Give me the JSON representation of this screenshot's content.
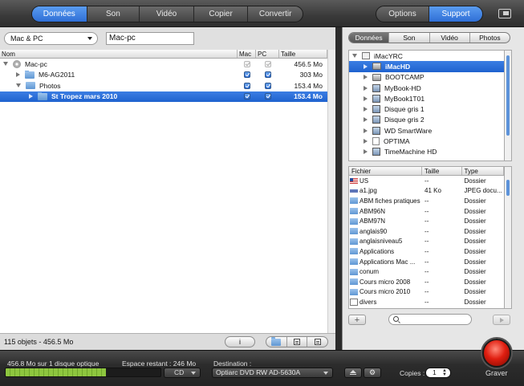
{
  "toolbar": {
    "left_tabs": [
      "Données",
      "Son",
      "Vidéo",
      "Copier",
      "Convertir"
    ],
    "right_tabs": [
      "Options",
      "Support"
    ],
    "window_icon": "window-toggle-icon"
  },
  "left": {
    "source_select": "Mac & PC",
    "disc_name": "Mac-pc",
    "columns": [
      "Nom",
      "Mac",
      "PC",
      "Taille"
    ],
    "rows": [
      {
        "name": "Mac-pc",
        "size": "456.5 Mo",
        "level": 0,
        "expanded": true,
        "icon": "disc-icon",
        "mac": "dim",
        "pc": "dim"
      },
      {
        "name": "M6-AG2011",
        "size": "303 Mo",
        "level": 1,
        "expanded": false,
        "icon": "folder-icon",
        "mac": "on",
        "pc": "on"
      },
      {
        "name": "Photos",
        "size": "153.4 Mo",
        "level": 1,
        "expanded": true,
        "icon": "folder-icon",
        "mac": "on",
        "pc": "on"
      },
      {
        "name": "St Tropez mars 2010",
        "size": "153.4 Mo",
        "level": 2,
        "expanded": false,
        "icon": "folder-icon",
        "mac": "on",
        "pc": "on",
        "selected": true
      }
    ],
    "status": "115 objets - 456.5 Mo",
    "info_label": "i"
  },
  "right": {
    "tabs": [
      "Données",
      "Son",
      "Vidéo",
      "Photos"
    ],
    "volumes": [
      {
        "name": "iMacYRC",
        "icon": "imac-icon",
        "level": 0,
        "expanded": true
      },
      {
        "name": "iMacHD",
        "icon": "hd-icon",
        "level": 1,
        "selected": true
      },
      {
        "name": "BOOTCAMP",
        "icon": "hd-icon",
        "level": 1
      },
      {
        "name": "MyBook-HD",
        "icon": "ext-icon",
        "level": 1
      },
      {
        "name": "MyBook1T01",
        "icon": "ext-icon",
        "level": 1
      },
      {
        "name": "Disque gris 1",
        "icon": "ext-icon",
        "level": 1
      },
      {
        "name": "Disque gris 2",
        "icon": "ext-icon",
        "level": 1
      },
      {
        "name": "WD SmartWare",
        "icon": "ext-icon",
        "level": 1
      },
      {
        "name": "OPTIMA",
        "icon": "blank-icon",
        "level": 1
      },
      {
        "name": "TimeMachine HD",
        "icon": "ext-icon",
        "level": 1
      }
    ],
    "file_columns": [
      "Fichier",
      "Taille",
      "Type"
    ],
    "files": [
      {
        "name": "US",
        "size": "--",
        "type": "Dossier",
        "icon": "flag"
      },
      {
        "name": "a1.jpg",
        "size": "41 Ko",
        "type": "JPEG docu...",
        "icon": "doc"
      },
      {
        "name": "ABM fiches pratiques",
        "size": "--",
        "type": "Dossier",
        "icon": "folder"
      },
      {
        "name": "ABM96N",
        "size": "--",
        "type": "Dossier",
        "icon": "folder"
      },
      {
        "name": "ABM97N",
        "size": "--",
        "type": "Dossier",
        "icon": "folder"
      },
      {
        "name": "anglais90",
        "size": "--",
        "type": "Dossier",
        "icon": "folder"
      },
      {
        "name": "anglaisniveau5",
        "size": "--",
        "type": "Dossier",
        "icon": "folder"
      },
      {
        "name": "Applications",
        "size": "--",
        "type": "Dossier",
        "icon": "folder"
      },
      {
        "name": "Applications Mac ...",
        "size": "--",
        "type": "Dossier",
        "icon": "folder"
      },
      {
        "name": "conum",
        "size": "--",
        "type": "Dossier",
        "icon": "folder"
      },
      {
        "name": "Cours micro 2008",
        "size": "--",
        "type": "Dossier",
        "icon": "folder"
      },
      {
        "name": "Cours micro 2010",
        "size": "--",
        "type": "Dossier",
        "icon": "folder"
      },
      {
        "name": "divers",
        "size": "--",
        "type": "Dossier",
        "icon": "alias"
      }
    ]
  },
  "bottom": {
    "capacity_text": "456.8 Mo sur 1 disque optique",
    "remaining_text": "Espace restant : 246 Mo",
    "capacity_fill_fraction": 0.65,
    "media": "CD",
    "destination_label": "Destination :",
    "destination": "Optiarc DVD RW AD-5630A",
    "copies_label": "Copies :",
    "copies": "1",
    "burn_label": "Graver"
  }
}
